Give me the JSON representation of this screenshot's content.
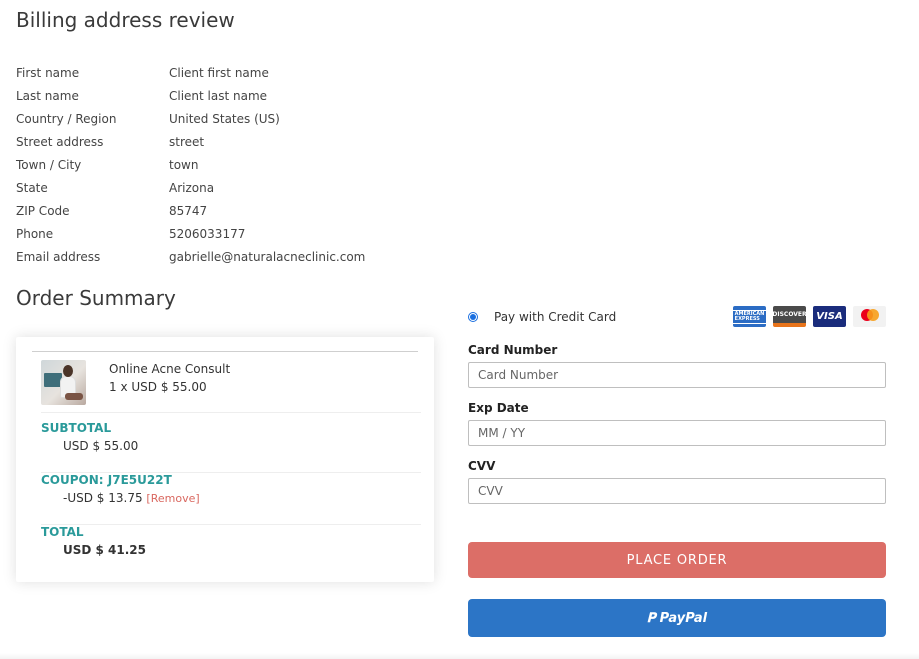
{
  "billing": {
    "title": "Billing address review",
    "fields": [
      {
        "label": "First name",
        "value": "Client first name"
      },
      {
        "label": "Last name",
        "value": "Client last name"
      },
      {
        "label": "Country / Region",
        "value": "United States (US)"
      },
      {
        "label": "Street address",
        "value": "street"
      },
      {
        "label": "Town / City",
        "value": "town"
      },
      {
        "label": "State",
        "value": "Arizona"
      },
      {
        "label": "ZIP Code",
        "value": "85747"
      },
      {
        "label": "Phone",
        "value": "5206033177"
      },
      {
        "label": "Email address",
        "value": "gabrielle@naturalacneclinic.com"
      }
    ]
  },
  "order": {
    "title": "Order Summary",
    "item": {
      "name": "Online Acne Consult",
      "qty": "1 x USD $ 55.00"
    },
    "subtotal": {
      "label": "SUBTOTAL",
      "value": "USD $ 55.00"
    },
    "coupon": {
      "label": "COUPON: J7E5U22T",
      "value": "-USD $ 13.75",
      "remove": "[Remove]"
    },
    "total": {
      "label": "TOTAL",
      "value": "USD $ 41.25"
    }
  },
  "payment": {
    "method_label": "Pay with Credit Card",
    "card_logos": [
      "amex-icon",
      "discover-icon",
      "visa-icon",
      "mastercard-icon"
    ],
    "logo_text": {
      "amex": "AMERICAN EXPRESS",
      "discover": "DISCOVER",
      "visa": "VISA"
    },
    "card_number": {
      "label": "Card Number",
      "placeholder": "Card Number"
    },
    "exp_date": {
      "label": "Exp Date",
      "placeholder": "MM / YY"
    },
    "cvv": {
      "label": "CVV",
      "placeholder": "CVV"
    },
    "place_order": "PLACE ORDER",
    "paypal": "PayPal"
  },
  "colors": {
    "accent": "#2a9a9a",
    "order_button": "#dc6e67",
    "paypal_button": "#2c75c6",
    "remove_link": "#d9675f"
  }
}
